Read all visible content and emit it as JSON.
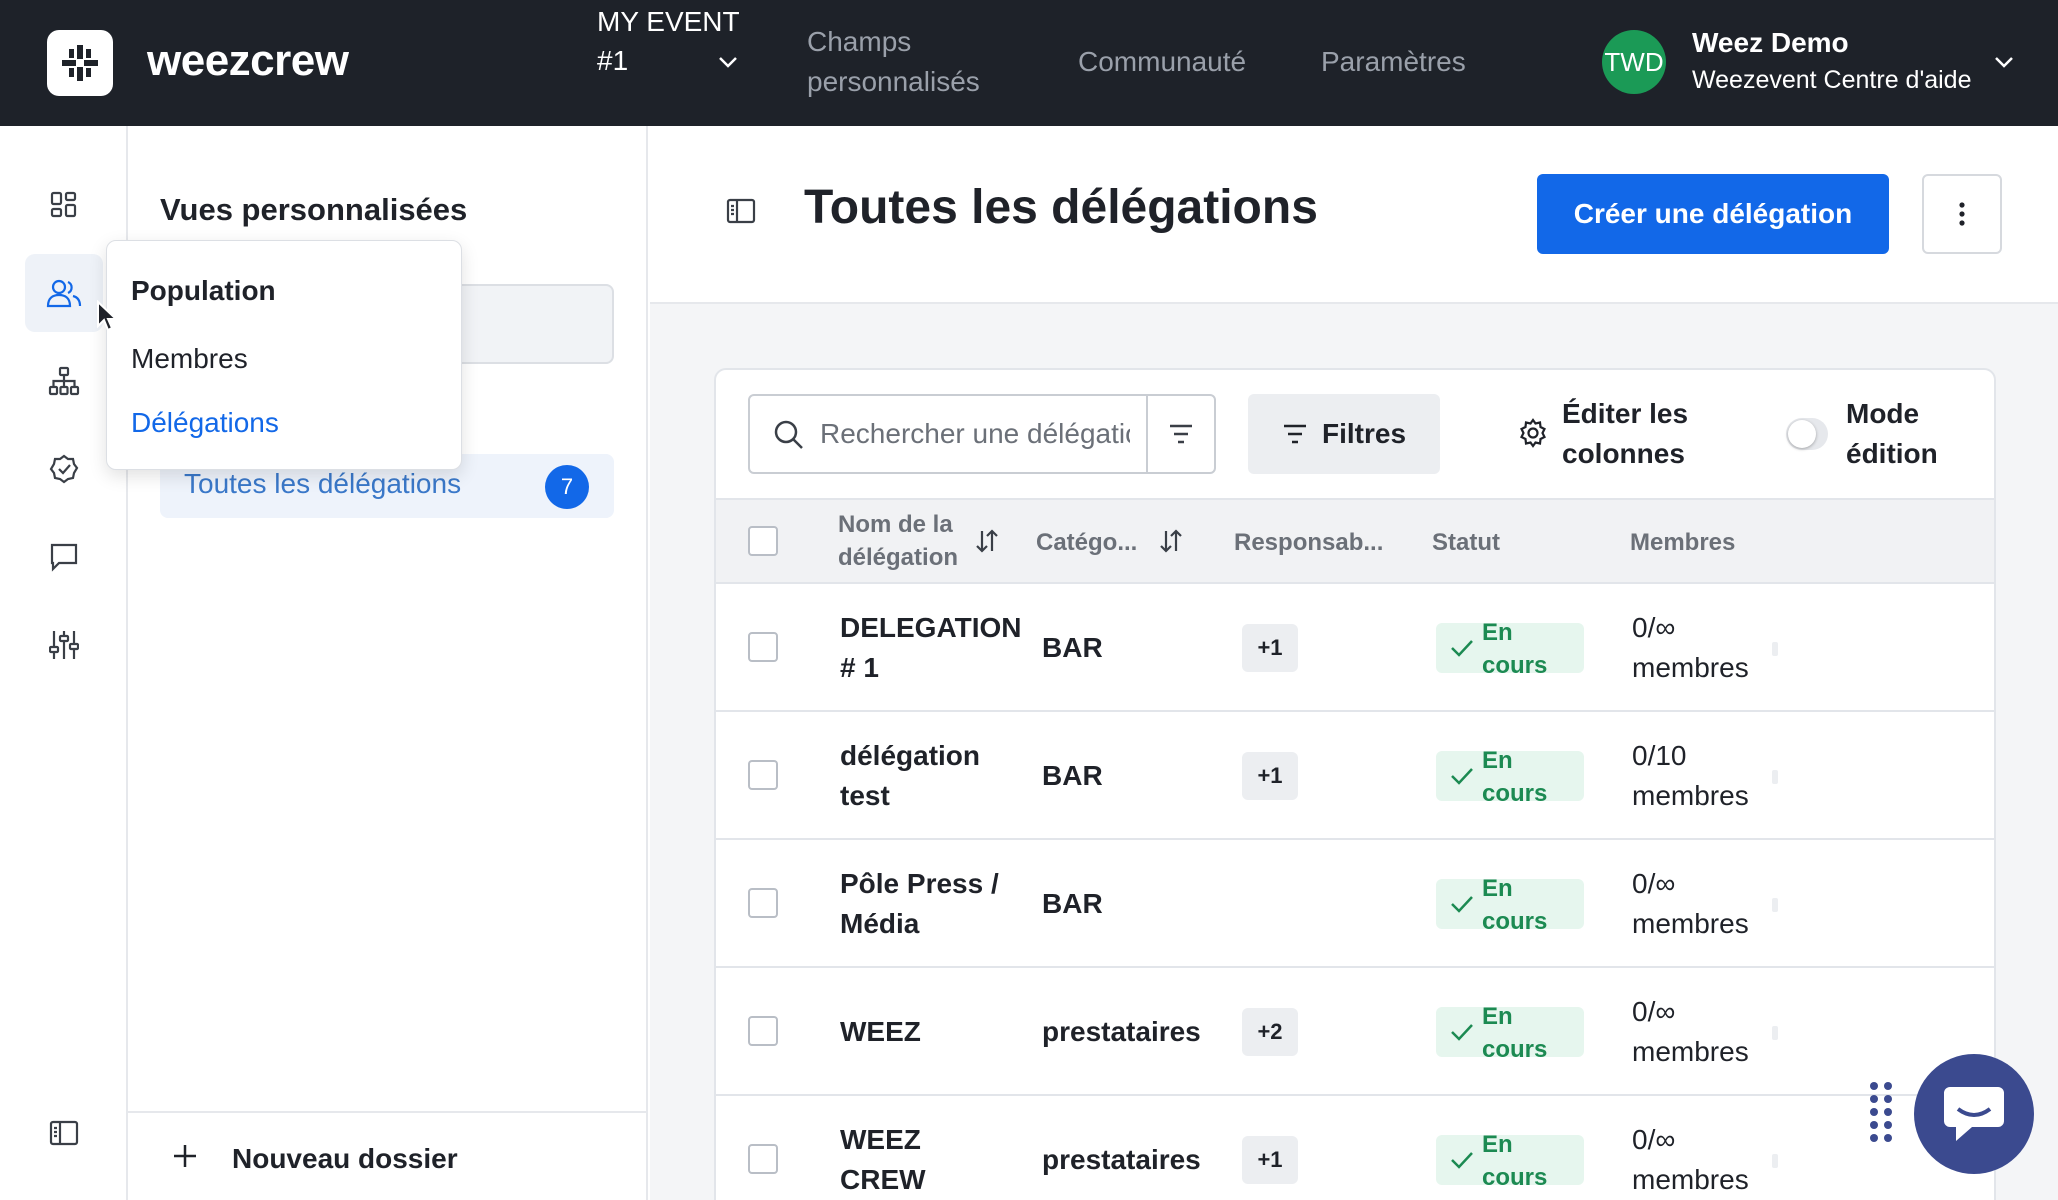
{
  "topbar": {
    "brand": "weezcrew",
    "event_selector": "MY EVENT #1",
    "nav": [
      "Champs personnalisés",
      "Communauté",
      "Paramètres"
    ],
    "user_initials": "TWD",
    "user_name": "Weez Demo",
    "user_sub": "Weezevent Centre d'aide",
    "colors": {
      "bar": "#1e2229",
      "avatar": "#1b9a56"
    }
  },
  "rail": {
    "icons": [
      "dashboard-icon",
      "population-icon",
      "organization-icon",
      "check-circle-icon",
      "chat-icon",
      "settings-sliders-icon",
      "panel-toggle-icon"
    ],
    "active": "population-icon"
  },
  "views": {
    "title": "Vues personnalisées",
    "item_label": "Toutes les délégations",
    "item_count": "7",
    "new_folder": "Nouveau dossier"
  },
  "popup": {
    "title": "Population",
    "items": [
      "Membres",
      "Délégations"
    ],
    "active_item": "Délégations"
  },
  "main": {
    "title": "Toutes les délégations",
    "create_button": "Créer une délégation",
    "search_placeholder": "Rechercher une délégation",
    "filters_label": "Filtres",
    "edit_columns": "Éditer les colonnes",
    "mode_edition": "Mode édition",
    "accent": "#1268e8"
  },
  "table": {
    "columns": [
      "Nom de la délégation",
      "Catégo...",
      "Responsab...",
      "Statut",
      "Membres"
    ],
    "rows": [
      {
        "name": "DELEGATION # 1",
        "category": "BAR",
        "responsible": "+1",
        "status": "En cours",
        "members": "0/∞ membres"
      },
      {
        "name": "délégation test",
        "category": "BAR",
        "responsible": "+1",
        "status": "En cours",
        "members": "0/10 membres"
      },
      {
        "name": "Pôle Press / Média",
        "category": "BAR",
        "responsible": "",
        "status": "En cours",
        "members": "0/∞ membres"
      },
      {
        "name": "WEEZ",
        "category": "prestataires",
        "responsible": "+2",
        "status": "En cours",
        "members": "0/∞ membres"
      },
      {
        "name": "WEEZ CREW",
        "category": "prestataires",
        "responsible": "+1",
        "status": "En cours",
        "members": "0/∞ membres"
      }
    ]
  }
}
